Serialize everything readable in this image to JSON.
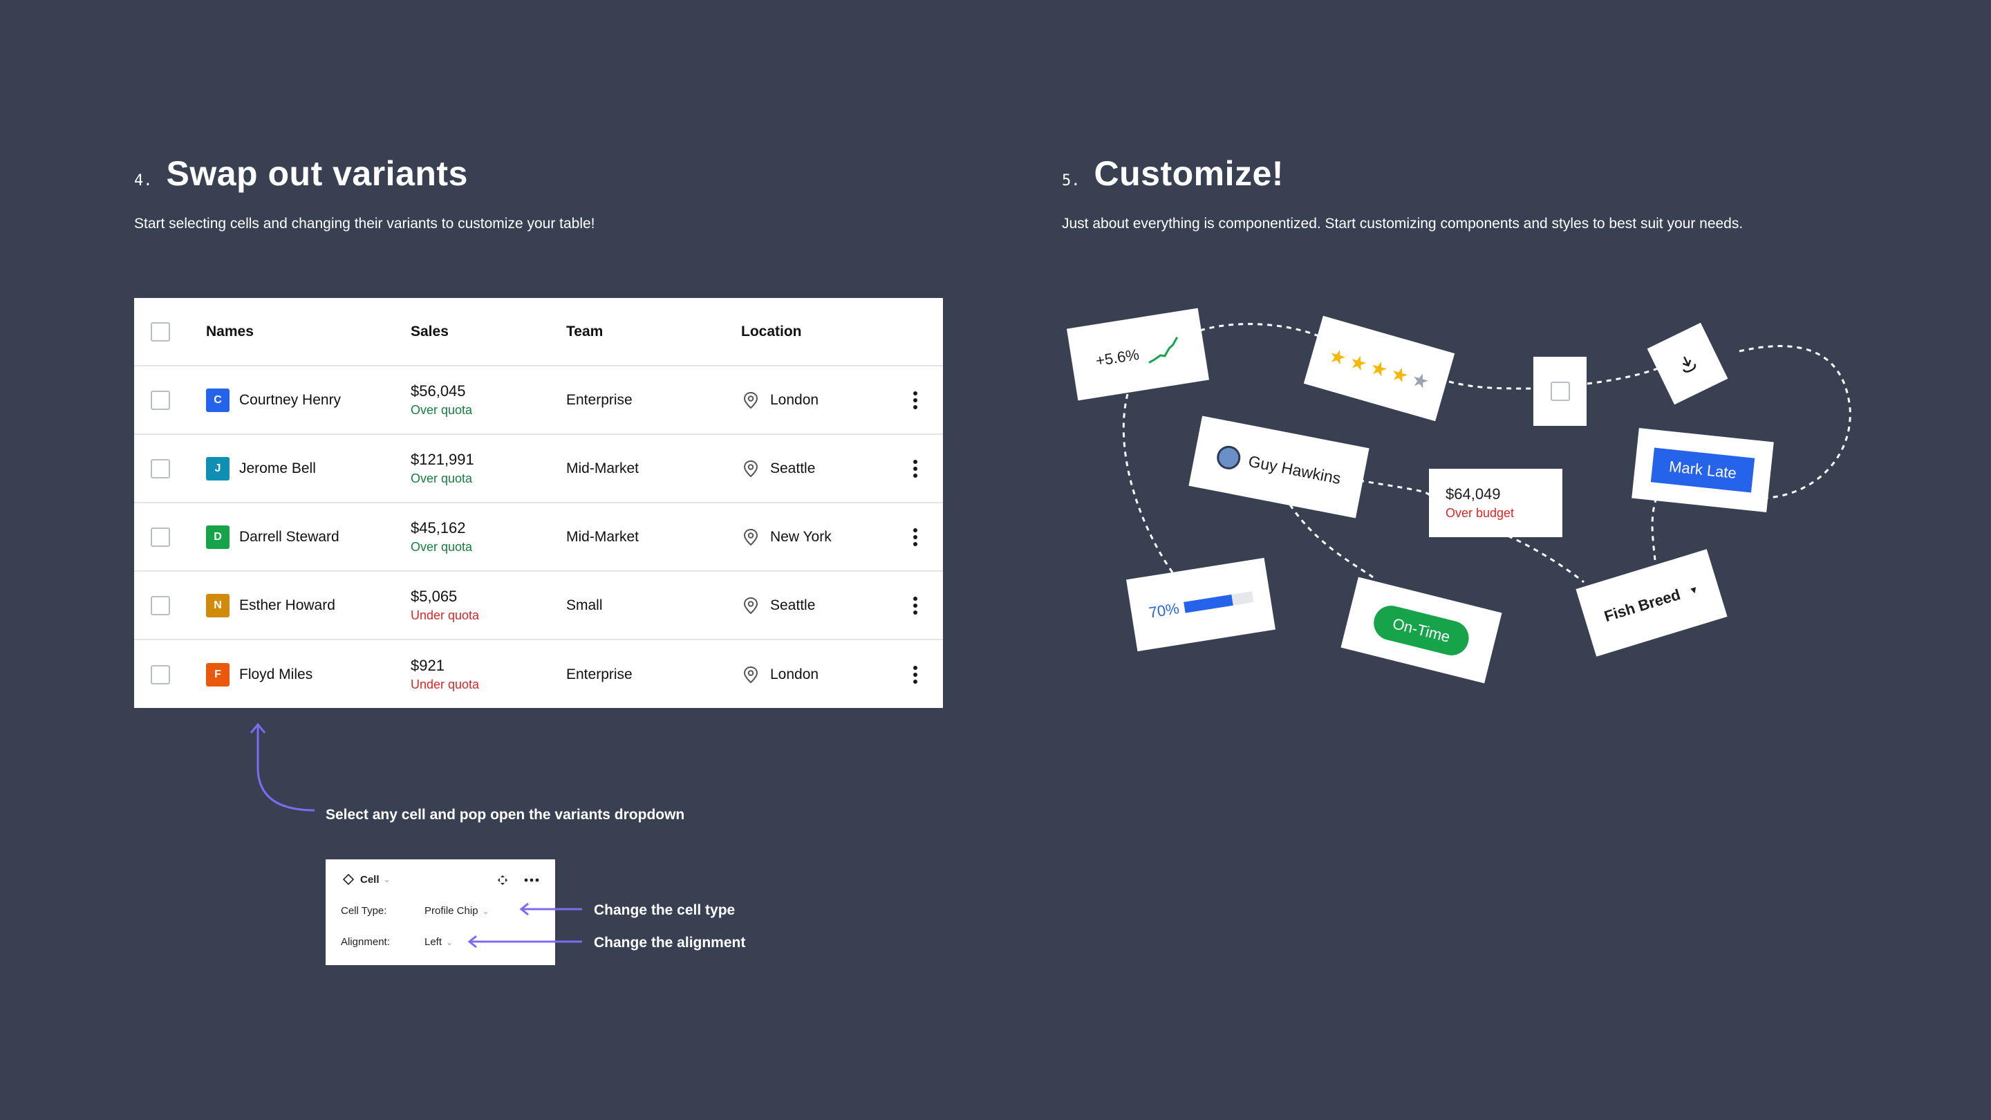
{
  "section4": {
    "number": "4.",
    "title": "Swap out variants",
    "subtitle": "Start selecting cells and changing their variants to customize your table!"
  },
  "section5": {
    "number": "5.",
    "title": "Customize!",
    "subtitle": "Just about everything is componentized. Start customizing components and styles to best suit your needs."
  },
  "table": {
    "headers": {
      "names": "Names",
      "sales": "Sales",
      "team": "Team",
      "location": "Location"
    },
    "rows": [
      {
        "initial": "C",
        "avatar_color": "#2563eb",
        "name": "Courtney Henry",
        "sales": "$56,045",
        "quota": "Over quota",
        "quota_color": "#15803d",
        "team": "Enterprise",
        "location": "London"
      },
      {
        "initial": "J",
        "avatar_color": "#0e8fb3",
        "name": "Jerome Bell",
        "sales": "$121,991",
        "quota": "Over quota",
        "quota_color": "#15803d",
        "team": "Mid-Market",
        "location": "Seattle"
      },
      {
        "initial": "D",
        "avatar_color": "#16a34a",
        "name": "Darrell Steward",
        "sales": "$45,162",
        "quota": "Over quota",
        "quota_color": "#15803d",
        "team": "Mid-Market",
        "location": "New York"
      },
      {
        "initial": "N",
        "avatar_color": "#d08a0c",
        "name": "Esther Howard",
        "sales": "$5,065",
        "quota": "Under quota",
        "quota_color": "#dc2626",
        "team": "Small",
        "location": "Seattle"
      },
      {
        "initial": "F",
        "avatar_color": "#ea580c",
        "name": "Floyd Miles",
        "sales": "$921",
        "quota": "Under quota",
        "quota_color": "#dc2626",
        "team": "Enterprise",
        "location": "London"
      }
    ]
  },
  "notes": {
    "select_cell": "Select any cell and pop open the variants dropdown",
    "change_type": "Change the cell type",
    "change_alignment": "Change the alignment"
  },
  "panel": {
    "title": "Cell",
    "cell_type_label": "Cell Type:",
    "cell_type_value": "Profile Chip",
    "alignment_label": "Alignment:",
    "alignment_value": "Left"
  },
  "custom": {
    "trend": "+5.6%",
    "rating": 4,
    "rating_max": 5,
    "profile_name": "Guy Hawkins",
    "budget_value": "$64,049",
    "budget_status": "Over budget",
    "mark_late": "Mark Late",
    "progress_label": "70%",
    "progress_value": 0.7,
    "on_time": "On-Time",
    "dropdown": "Fish Breed"
  },
  "colors": {
    "background": "#384052",
    "accent_purple": "#7c6cf0",
    "success": "#16a34a",
    "danger": "#dc2626",
    "primary": "#2563eb",
    "star": "#f5b70a"
  }
}
